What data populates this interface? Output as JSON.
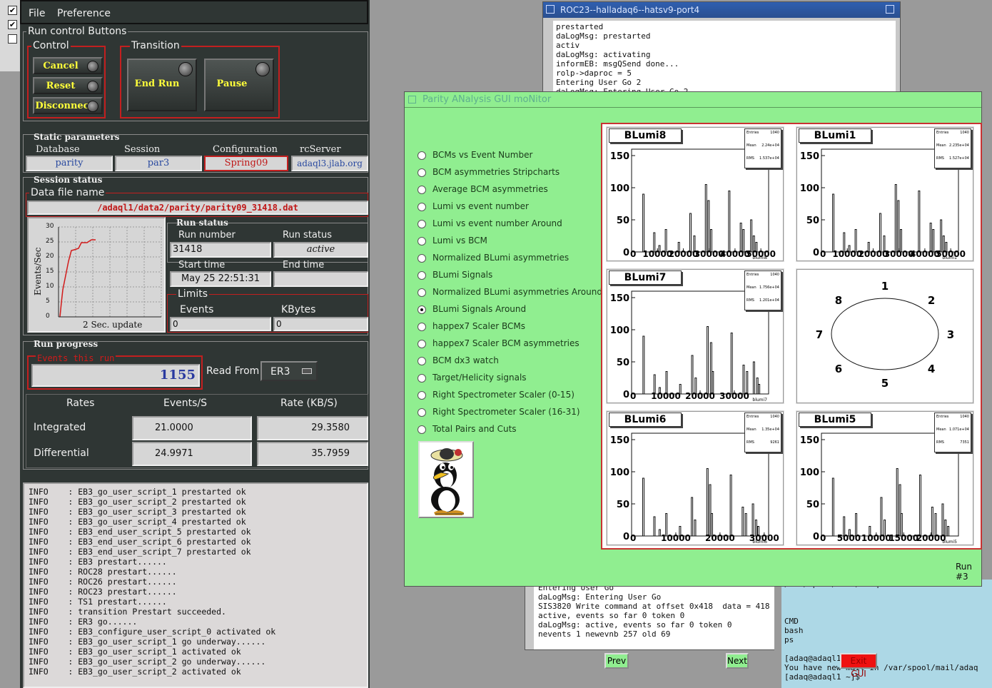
{
  "left_strip": {
    "checks": [
      "✔",
      "✔",
      ""
    ]
  },
  "runcontrol": {
    "menu": [
      "File",
      "Preference"
    ],
    "run_control_title": "Run control Buttons",
    "control_title": "Control",
    "transition_title": "Transition",
    "buttons": {
      "cancel": "Cancel",
      "reset": "Reset",
      "disconnect": "Disconnect",
      "end_run": "End Run",
      "pause": "Pause"
    },
    "static_params_title": "Static parameters",
    "static": {
      "database_label": "Database",
      "database_value": "parity",
      "session_label": "Session",
      "session_value": "par3",
      "config_label": "Configuration",
      "config_value": "Spring09",
      "rcserver_label": "rcServer",
      "rcserver_value": "adaql3.jlab.org"
    },
    "session_status_title": "Session status",
    "datafile_label": "Data file name",
    "datafile_value": "/adaql1/data2/parity/parity09_31418.dat",
    "plot": {
      "ylabel": "Events/Sec",
      "caption": "2 Sec. update",
      "yticks": [
        "30",
        "25",
        "20",
        "15",
        "10",
        "5",
        "0"
      ]
    },
    "run_status_title": "Run status",
    "run_number_label": "Run number",
    "run_number_value": "31418",
    "run_status_label": "Run status",
    "run_status_value": "active",
    "start_time_label": "Start time",
    "start_time_value": "May 25 22:51:31",
    "end_time_label": "End time",
    "end_time_value": "",
    "limits_label": "Limits",
    "events_label": "Events",
    "events_value": "0",
    "kbytes_label": "KBytes",
    "kbytes_value": "0",
    "run_progress_title": "Run progress",
    "events_this_run_label": "Events this run",
    "events_this_run_value": "1155",
    "read_from_label": "Read From:",
    "read_from_value": "ER3",
    "rates": {
      "header": [
        "Rates",
        "Events/S",
        "Rate (KB/S)"
      ],
      "integrated_label": "Integrated",
      "integrated_events": "21.0000",
      "integrated_rate": "29.3580",
      "differential_label": "Differential",
      "differential_events": "24.9971",
      "differential_rate": "35.7959"
    },
    "log_lines": [
      "INFO    : EB3_go_user_script_1 prestarted ok",
      "INFO    : EB3_go_user_script_2 prestarted ok",
      "INFO    : EB3_go_user_script_3 prestarted ok",
      "INFO    : EB3_go_user_script_4 prestarted ok",
      "INFO    : EB3_end_user_script_5 prestarted ok",
      "INFO    : EB3_end_user_script_6 prestarted ok",
      "INFO    : EB3_end_user_script_7 prestarted ok",
      "INFO    : EB3 prestart......",
      "INFO    : ROC28 prestart......",
      "INFO    : ROC26 prestart......",
      "INFO    : ROC23 prestart......",
      "INFO    : TS1 prestart......",
      "INFO    : transition Prestart succeeded.",
      "INFO    : ER3 go......",
      "INFO    : EB3_configure_user_script_0 activated ok",
      "INFO    : EB3_go_user_script_1 go underway......",
      "INFO    : EB3_go_user_script_1 activated ok",
      "INFO    : EB3_go_user_script_2 go underway......",
      "INFO    : EB3_go_user_script_2 activated ok"
    ]
  },
  "roc23": {
    "title": "ROC23--halladaq6--hatsv9-port4",
    "lines": [
      "prestarted",
      "daLogMsg: prestarted",
      "activ",
      "daLogMsg: activating",
      "informEB: msgQSend done...",
      "rolp->daproc = 5",
      "Entering User Go 2",
      "daLogMsg: Entering User Go 2"
    ]
  },
  "term2": {
    "lines": [
      "Entering User Go",
      "daLogMsg: Entering User Go",
      "SIS3820 Write command at offset 0x418  data = 418",
      "active, events so far 0 token 0",
      "daLogMsg: active, events so far 0 token 0",
      "nevents 1 newevnb 257 old 69"
    ]
  },
  "term3": {
    "lines": [
      "/var/spool/mail/adaq",
      "",
      "",
      "",
      "CMD",
      "bash",
      "ps",
      "",
      "[adaq@adaql1 ~]$",
      "You have new mail in /var/spool/mail/adaq",
      "[adaq@adaql1 ~]$"
    ]
  },
  "pan": {
    "title": "Parity ANalysis GUI moNitor",
    "options": [
      "BCMs vs Event Number",
      "BCM asymmetries Stripcharts",
      "Average BCM asymmetries",
      "Lumi vs event number",
      "Lumi vs event number Around",
      "Lumi vs BCM",
      "Normalized BLumi asymmetries",
      "BLumi Signals",
      "Normalized BLumi asymmetries Around",
      "BLumi Signals Around",
      "happex7 Scaler BCMs",
      "happex7 Scaler BCM asymmetries",
      "BCM dx3 watch",
      "Target/Helicity signals",
      "Right Spectrometer Scaler (0-15)",
      "Right Spectrometer Scaler (16-31)",
      "Total Pairs and Cuts"
    ],
    "selected_index": 9,
    "prev_label": "Prev",
    "next_label": "Next",
    "exit_label": "Exit GUI",
    "run_label": "Run #3",
    "stats_labels": [
      "Entries",
      "Mean",
      "RMS"
    ],
    "histograms": [
      {
        "title": "BLumi8",
        "xname": "blumi8",
        "entries": "1040",
        "mean": "2.24e+04",
        "rms": "1.537e+04",
        "yticks": [
          "150",
          "100",
          "50",
          "0"
        ],
        "xticks": [
          "10000",
          "20000",
          "30000",
          "40000",
          "50000"
        ],
        "xmax": 53000,
        "bars": [
          [
            4300,
            90
          ],
          [
            8500,
            30
          ],
          [
            10500,
            10
          ],
          [
            13000,
            35
          ],
          [
            18000,
            15
          ],
          [
            22500,
            60
          ],
          [
            24000,
            25
          ],
          [
            28500,
            105
          ],
          [
            29500,
            80
          ],
          [
            30500,
            35
          ],
          [
            37500,
            95
          ],
          [
            42000,
            45
          ],
          [
            43000,
            35
          ],
          [
            46000,
            50
          ],
          [
            47000,
            25
          ],
          [
            48000,
            15
          ]
        ]
      },
      {
        "title": "BLumi1",
        "xname": "blumi1",
        "entries": "1040",
        "mean": "2.235e+04",
        "rms": "1.527e+04",
        "yticks": [
          "150",
          "100",
          "50",
          "0"
        ],
        "xticks": [
          "10000",
          "20000",
          "30000",
          "40000",
          "50000"
        ],
        "xmax": 53000,
        "bars": [
          [
            4300,
            90
          ],
          [
            8500,
            30
          ],
          [
            10500,
            10
          ],
          [
            13000,
            35
          ],
          [
            18000,
            15
          ],
          [
            22500,
            60
          ],
          [
            24000,
            25
          ],
          [
            28500,
            105
          ],
          [
            29500,
            80
          ],
          [
            30500,
            35
          ],
          [
            37500,
            95
          ],
          [
            42000,
            45
          ],
          [
            43000,
            35
          ],
          [
            46000,
            50
          ],
          [
            47000,
            25
          ],
          [
            48000,
            15
          ]
        ]
      },
      {
        "title": "BLumi7",
        "xname": "blumi7",
        "entries": "1040",
        "mean": "1.756e+04",
        "rms": "1.201e+04",
        "yticks": [
          "150",
          "100",
          "50",
          "0"
        ],
        "xticks": [
          "10000",
          "20000",
          "30000"
        ],
        "xmax": 40000,
        "bars": [
          [
            3300,
            90
          ],
          [
            6500,
            30
          ],
          [
            8000,
            10
          ],
          [
            10000,
            35
          ],
          [
            14000,
            15
          ],
          [
            17500,
            60
          ],
          [
            18500,
            25
          ],
          [
            22000,
            105
          ],
          [
            23000,
            80
          ],
          [
            23500,
            35
          ],
          [
            29000,
            95
          ],
          [
            32500,
            45
          ],
          [
            33500,
            35
          ],
          [
            35500,
            50
          ],
          [
            36500,
            25
          ],
          [
            37000,
            15
          ]
        ]
      },
      {
        "title": "BLumi6",
        "xname": "blumi6",
        "entries": "1040",
        "mean": "1.35e+04",
        "rms": "9261",
        "yticks": [
          "150",
          "100",
          "50",
          "0"
        ],
        "xticks": [
          "10000",
          "20000",
          "30000"
        ],
        "xmax": 31000,
        "bars": [
          [
            2500,
            90
          ],
          [
            5000,
            30
          ],
          [
            6200,
            10
          ],
          [
            7700,
            35
          ],
          [
            10800,
            15
          ],
          [
            13500,
            60
          ],
          [
            14200,
            25
          ],
          [
            17000,
            105
          ],
          [
            17600,
            80
          ],
          [
            18000,
            35
          ],
          [
            22300,
            95
          ],
          [
            25000,
            45
          ],
          [
            25700,
            35
          ],
          [
            27300,
            50
          ],
          [
            28000,
            25
          ],
          [
            28500,
            15
          ]
        ]
      },
      {
        "title": "BLumi5",
        "xname": "blumi5",
        "entries": "1040",
        "mean": "1.071e+04",
        "rms": "7351",
        "yticks": [
          "150",
          "100",
          "50",
          "0"
        ],
        "xticks": [
          "5000",
          "10000",
          "15000",
          "20000"
        ],
        "xmax": 25000,
        "bars": [
          [
            2000,
            90
          ],
          [
            4000,
            30
          ],
          [
            5000,
            10
          ],
          [
            6200,
            35
          ],
          [
            8700,
            15
          ],
          [
            10800,
            60
          ],
          [
            11400,
            25
          ],
          [
            13700,
            105
          ],
          [
            14200,
            80
          ],
          [
            14500,
            35
          ],
          [
            17900,
            95
          ],
          [
            20100,
            45
          ],
          [
            20700,
            35
          ],
          [
            22000,
            50
          ],
          [
            22500,
            25
          ],
          [
            23000,
            15
          ]
        ]
      }
    ],
    "clock_labels": [
      "1",
      "2",
      "3",
      "4",
      "5",
      "6",
      "7",
      "8"
    ]
  }
}
